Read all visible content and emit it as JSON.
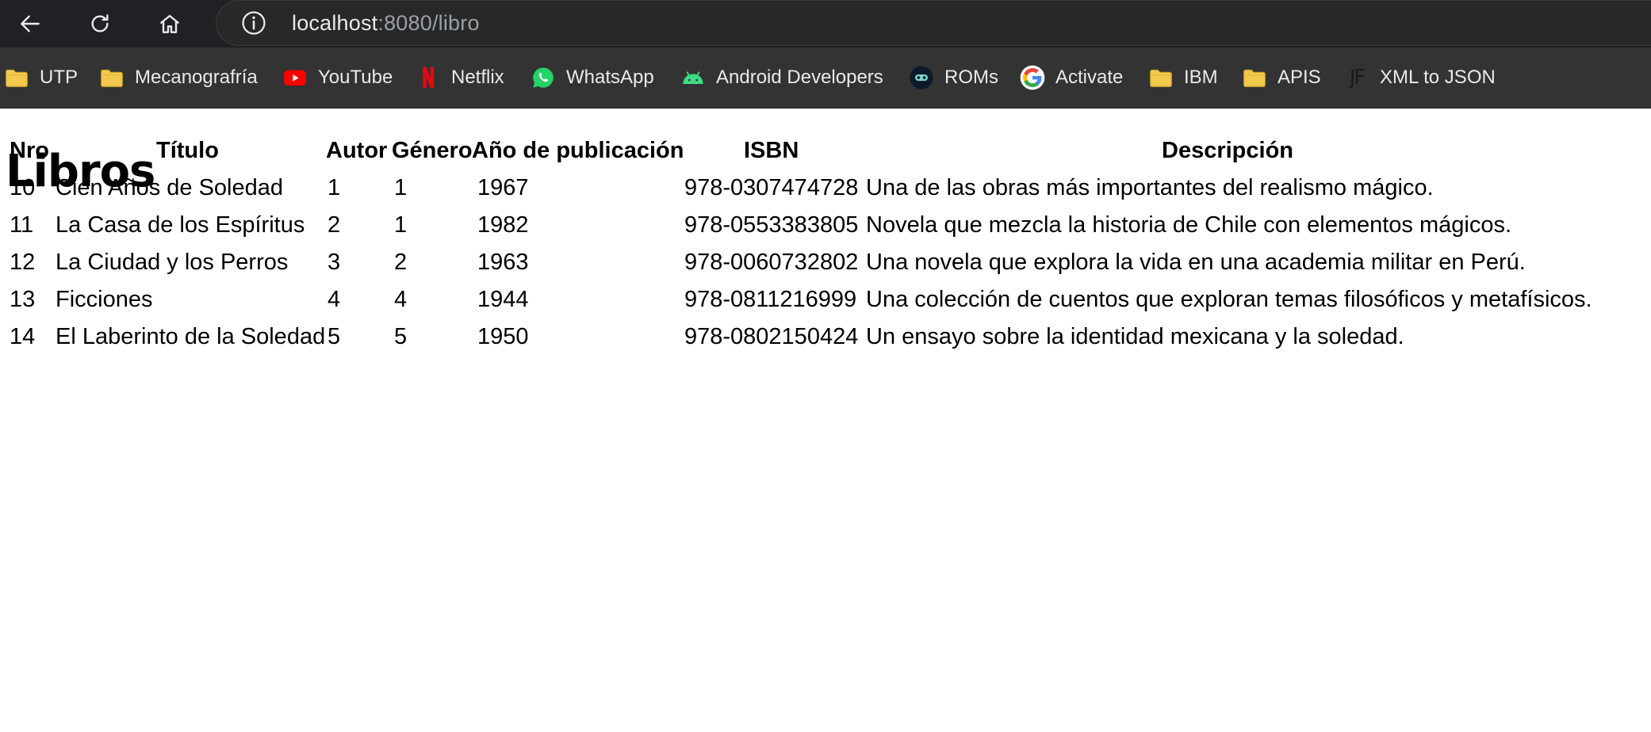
{
  "browser": {
    "url_host": "localhost",
    "url_rest": ":8080/libro",
    "nav": [
      {
        "name": "back-button",
        "icon": "back-arrow-icon"
      },
      {
        "name": "reload-button",
        "icon": "reload-icon"
      },
      {
        "name": "home-button",
        "icon": "home-icon"
      }
    ],
    "bookmarks": [
      {
        "label": "UTP",
        "icon": "folder-icon"
      },
      {
        "label": "Mecanografría",
        "icon": "folder-icon"
      },
      {
        "label": "YouTube",
        "icon": "youtube-icon"
      },
      {
        "label": "Netflix",
        "icon": "netflix-icon"
      },
      {
        "label": "WhatsApp",
        "icon": "whatsapp-icon"
      },
      {
        "label": "Android Developers",
        "icon": "android-icon"
      },
      {
        "label": "ROMs",
        "icon": "roms-icon"
      },
      {
        "label": "Activate",
        "icon": "google-icon"
      },
      {
        "label": "IBM",
        "icon": "folder-icon"
      },
      {
        "label": "APIS",
        "icon": "folder-icon"
      },
      {
        "label": "XML to JSON",
        "icon": "jf-icon"
      }
    ]
  },
  "page": {
    "title": "Libros",
    "table": {
      "headers": [
        "Nro",
        "Título",
        "Autor",
        "Género",
        "Año de publicación",
        "ISBN",
        "Descripción"
      ],
      "rows": [
        [
          "10",
          "Cien Años de Soledad",
          "1",
          "1",
          "1967",
          "978-0307474728",
          "Una de las obras más importantes del realismo mágico."
        ],
        [
          "11",
          "La Casa de los Espíritus",
          "2",
          "1",
          "1982",
          "978-0553383805",
          "Novela que mezcla la historia de Chile con elementos mágicos."
        ],
        [
          "12",
          "La Ciudad y los Perros",
          "3",
          "2",
          "1963",
          "978-0060732802",
          "Una novela que explora la vida en una academia militar en Perú."
        ],
        [
          "13",
          "Ficciones",
          "4",
          "4",
          "1944",
          "978-0811216999",
          "Una colección de cuentos que exploran temas filosóficos y metafísicos."
        ],
        [
          "14",
          "El Laberinto de la Soledad",
          "5",
          "5",
          "1950",
          "978-0802150424",
          "Un ensayo sobre la identidad mexicana y la soledad."
        ]
      ]
    }
  },
  "colors": {
    "chrome_dark": "#202124",
    "bookmarks_bar": "#333333",
    "folder_yellow": "#f2c94c",
    "youtube_red": "#ff0000",
    "netflix_red": "#e50914",
    "whatsapp_green": "#25d366",
    "android_green": "#3ddc84"
  }
}
